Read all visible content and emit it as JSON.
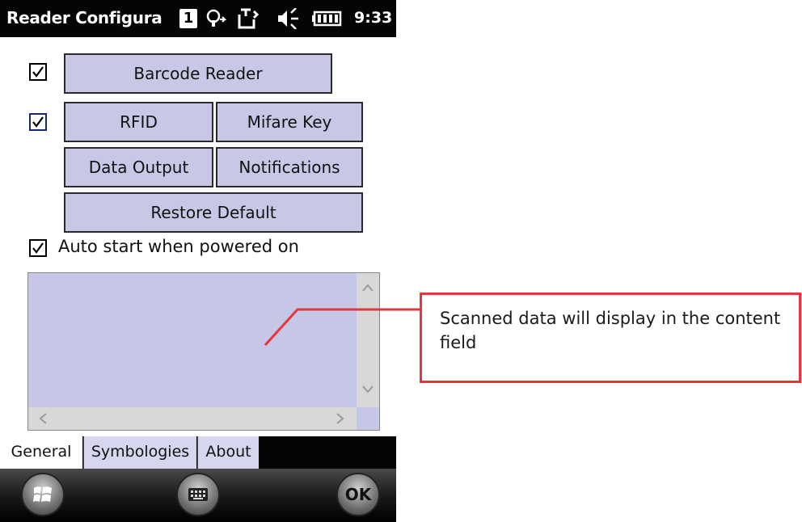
{
  "titlebar": {
    "app_title": "Reader Configura",
    "notification_count": "1",
    "clock": "9:33",
    "icons": [
      "notification-badge-icon",
      "connectivity-icon",
      "sync-icon",
      "speaker-muted-icon",
      "battery-icon"
    ]
  },
  "options": {
    "barcode_reader_checked": true,
    "rfid_checked": true,
    "auto_start_checked": true,
    "auto_start_label": "Auto start when powered on"
  },
  "buttons": {
    "barcode_reader": "Barcode Reader",
    "rfid": "RFID",
    "mifare_key": "Mifare Key",
    "data_output": "Data Output",
    "notifications": "Notifications",
    "restore_default": "Restore Default"
  },
  "content_field": {
    "value": ""
  },
  "tabs": [
    {
      "label": "General",
      "active": true
    },
    {
      "label": "Symbologies",
      "active": false
    },
    {
      "label": "About",
      "active": false
    }
  ],
  "softkeys": {
    "start_icon": "windows-start-icon",
    "keyboard_icon": "keyboard-icon",
    "ok_label": "OK"
  },
  "callout": {
    "text": "Scanned data will display in the content field",
    "color": "#e8353c"
  },
  "colors": {
    "button_bg": "#c8c8e6",
    "content_bg": "#c6c6e6",
    "titlebar_bg": "#050505"
  }
}
